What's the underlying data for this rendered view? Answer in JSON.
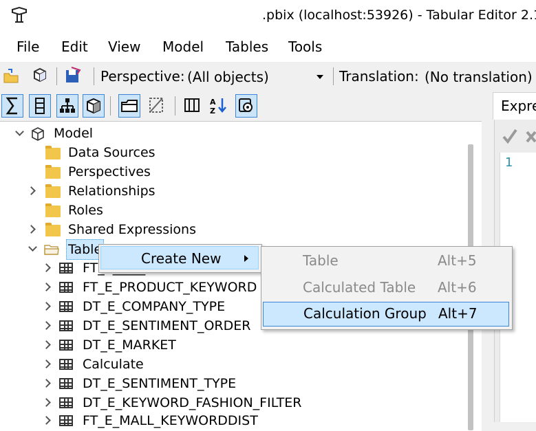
{
  "window": {
    "title_suffix": ".pbix (localhost:53926) - Tabular Editor 2.1"
  },
  "menu": [
    "File",
    "Edit",
    "View",
    "Model",
    "Tables",
    "Tools"
  ],
  "toolbar": {
    "perspective_label": "Perspective:",
    "perspective_value": "(All objects)",
    "translation_label": "Translation:",
    "translation_value": "(No translation)"
  },
  "right_pane": {
    "tab_label": "Expre",
    "line_number": "1"
  },
  "tree": {
    "root": "Model",
    "folders": [
      {
        "label": "Data Sources",
        "expander": "none"
      },
      {
        "label": "Perspectives",
        "expander": "none"
      },
      {
        "label": "Relationships",
        "expander": "collapsed"
      },
      {
        "label": "Roles",
        "expander": "none"
      },
      {
        "label": "Shared Expressions",
        "expander": "collapsed"
      }
    ],
    "selected_folder": "Table",
    "tables": [
      "FT_E_____E",
      "FT_E_PRODUCT_KEYWORD",
      "DT_E_COMPANY_TYPE",
      "DT_E_SENTIMENT_ORDER",
      "DT_E_MARKET",
      "Calculate",
      "DT_E_SENTIMENT_TYPE",
      "DT_E_KEYWORD_FASHION_FILTER",
      "FT_E_MALL_KEYWORDDIST"
    ]
  },
  "context_menu": {
    "item": "Create New"
  },
  "submenu": {
    "items": [
      {
        "label": "Table",
        "shortcut": "Alt+5",
        "enabled": false
      },
      {
        "label": "Calculated Table",
        "shortcut": "Alt+6",
        "enabled": false
      },
      {
        "label": "Calculation Group",
        "shortcut": "Alt+7",
        "enabled": true
      }
    ]
  }
}
